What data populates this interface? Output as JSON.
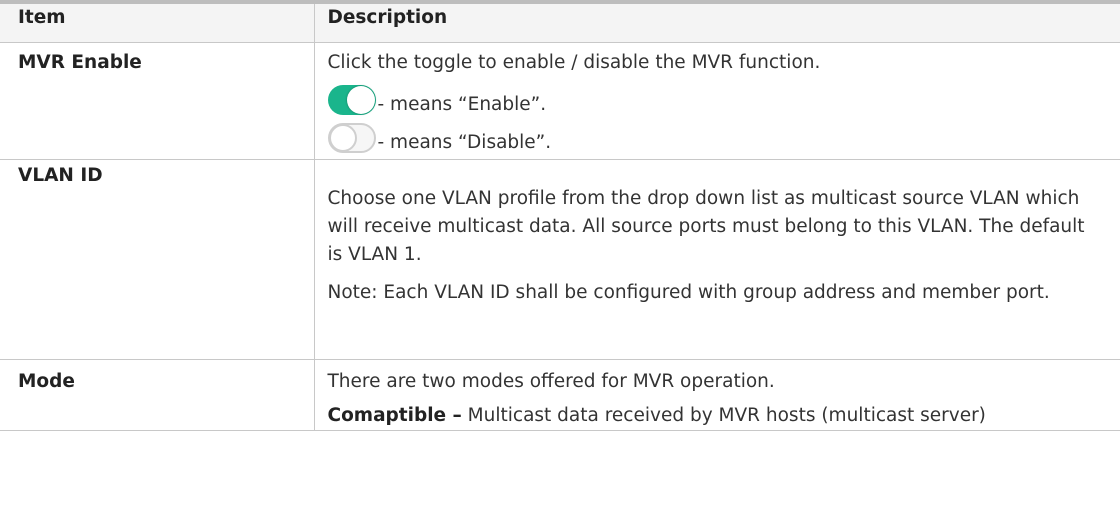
{
  "table": {
    "header": {
      "item": "Item",
      "description": "Description"
    },
    "rows": {
      "mvr_enable": {
        "item": "MVR Enable",
        "intro": "Click the toggle to enable / disable the MVR function.",
        "enable_text": "- means “Enable”.",
        "disable_text": "- means “Disable”."
      },
      "vlan_id": {
        "item": "VLAN ID",
        "desc1": "Choose one VLAN profile from the drop down list as multicast source VLAN which will receive multicast data. All source ports must belong to this VLAN. The default is VLAN 1.",
        "desc2": "Note: Each VLAN ID shall be configured with group address and member port."
      },
      "mode": {
        "item": "Mode",
        "intro": "There are two modes offered for MVR operation.",
        "compatible_label": "Comaptible –",
        "compatible_text": " Multicast data received by MVR hosts (multicast server)"
      }
    }
  },
  "colors": {
    "toggle_on": "#1ab58c",
    "toggle_off_border": "#cfcfcf",
    "header_bg": "#f4f4f4"
  },
  "icons": {
    "enable": "toggle-on-icon",
    "disable": "toggle-off-icon"
  }
}
